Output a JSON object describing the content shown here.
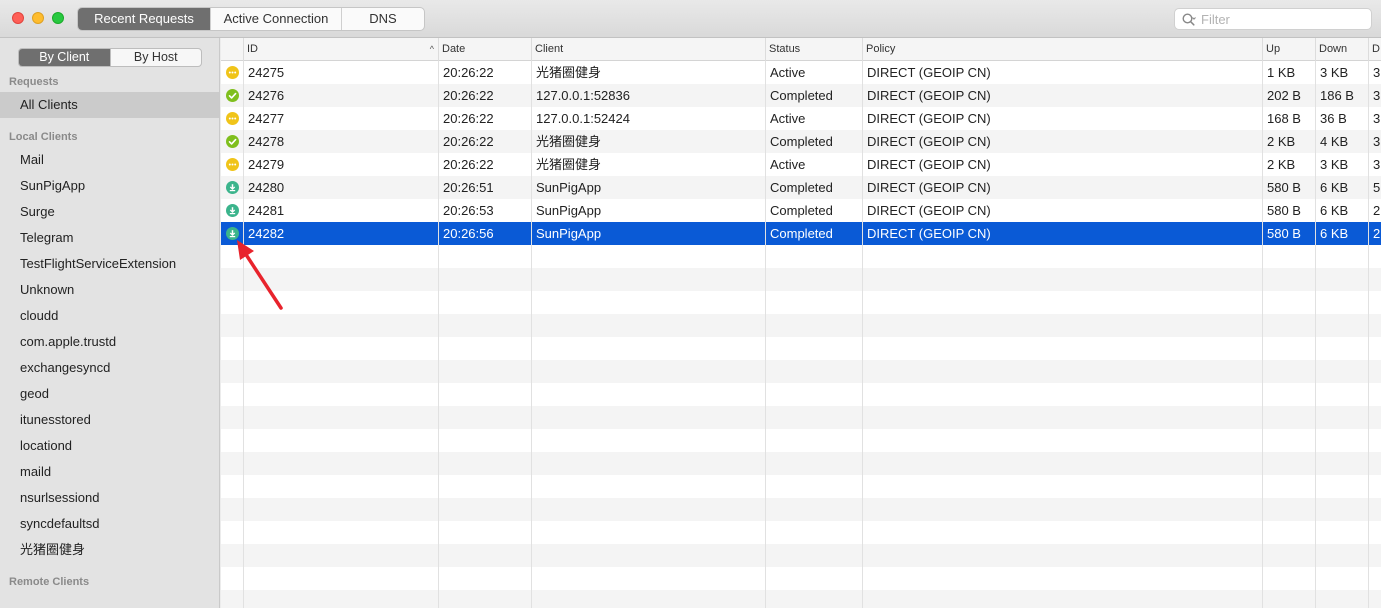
{
  "toolbar": {
    "tabs": [
      {
        "label": "Recent Requests",
        "active": true
      },
      {
        "label": "Active Connection",
        "active": false
      },
      {
        "label": "DNS",
        "active": false
      }
    ],
    "filter_placeholder": "Filter"
  },
  "sidebar": {
    "toggle": [
      {
        "label": "By Client",
        "active": true
      },
      {
        "label": "By Host",
        "active": false
      }
    ],
    "sections": {
      "requests": "Requests",
      "local": "Local Clients",
      "remote": "Remote Clients"
    },
    "all_clients": "All Clients",
    "local_clients": [
      "Mail",
      "SunPigApp",
      "Surge",
      "Telegram",
      "TestFlightServiceExtension",
      "Unknown",
      "cloudd",
      "com.apple.trustd",
      "exchangesyncd",
      "geod",
      "itunesstored",
      "locationd",
      "maild",
      "nsurlsessiond",
      "syncdefaultsd",
      "光猪圈健身"
    ]
  },
  "table": {
    "columns": [
      "",
      "ID",
      "Date",
      "Client",
      "Status",
      "Policy",
      "Up",
      "Down",
      "D"
    ],
    "rows": [
      {
        "icon": "active",
        "id": "24275",
        "date": "20:26:22",
        "client": "光猪圈健身",
        "status": "Active",
        "policy": "DIRECT (GEOIP CN)",
        "up": "1 KB",
        "down": "3 KB",
        "extra": "3"
      },
      {
        "icon": "completed",
        "id": "24276",
        "date": "20:26:22",
        "client": "127.0.0.1:52836",
        "status": "Completed",
        "policy": "DIRECT (GEOIP CN)",
        "up": "202 B",
        "down": "186 B",
        "extra": "3"
      },
      {
        "icon": "active",
        "id": "24277",
        "date": "20:26:22",
        "client": "127.0.0.1:52424",
        "status": "Active",
        "policy": "DIRECT (GEOIP CN)",
        "up": "168 B",
        "down": "36 B",
        "extra": "3"
      },
      {
        "icon": "completed",
        "id": "24278",
        "date": "20:26:22",
        "client": "光猪圈健身",
        "status": "Completed",
        "policy": "DIRECT (GEOIP CN)",
        "up": "2 KB",
        "down": "4 KB",
        "extra": "3"
      },
      {
        "icon": "active",
        "id": "24279",
        "date": "20:26:22",
        "client": "光猪圈健身",
        "status": "Active",
        "policy": "DIRECT (GEOIP CN)",
        "up": "2 KB",
        "down": "3 KB",
        "extra": "3"
      },
      {
        "icon": "download",
        "id": "24280",
        "date": "20:26:51",
        "client": "SunPigApp",
        "status": "Completed",
        "policy": "DIRECT (GEOIP CN)",
        "up": "580 B",
        "down": "6 KB",
        "extra": "5"
      },
      {
        "icon": "download",
        "id": "24281",
        "date": "20:26:53",
        "client": "SunPigApp",
        "status": "Completed",
        "policy": "DIRECT (GEOIP CN)",
        "up": "580 B",
        "down": "6 KB",
        "extra": "2"
      },
      {
        "icon": "download",
        "id": "24282",
        "date": "20:26:56",
        "client": "SunPigApp",
        "status": "Completed",
        "policy": "DIRECT (GEOIP CN)",
        "up": "580 B",
        "down": "6 KB",
        "extra": "2",
        "selected": true
      }
    ]
  },
  "colors": {
    "selection": "#0a5ad6",
    "active_icon": "#f0c419",
    "completed_icon": "#7fbf1d",
    "download_icon": "#3bb48c",
    "annotation_arrow": "#e8232c"
  }
}
